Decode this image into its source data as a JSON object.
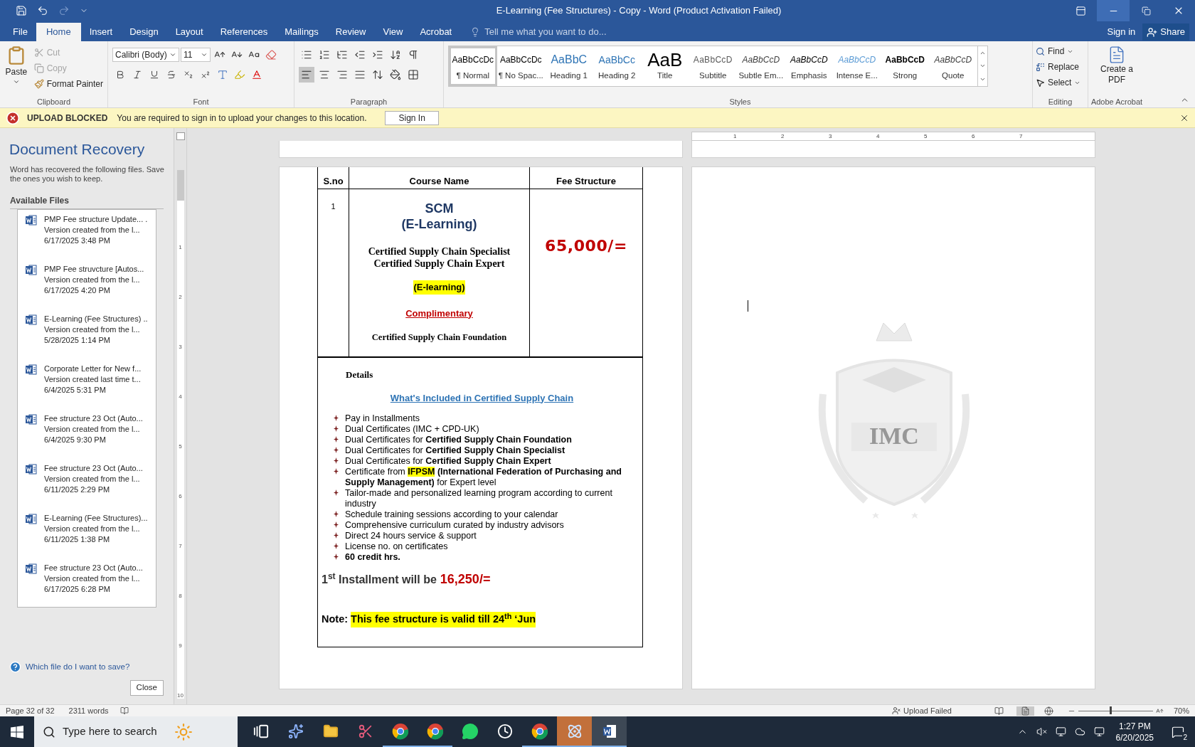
{
  "window": {
    "title": "E-Learning (Fee Structures) - Copy - Word (Product Activation Failed)"
  },
  "menu_tabs": [
    {
      "label": "File",
      "selected": false
    },
    {
      "label": "Home",
      "selected": true
    },
    {
      "label": "Insert",
      "selected": false
    },
    {
      "label": "Design",
      "selected": false
    },
    {
      "label": "Layout",
      "selected": false
    },
    {
      "label": "References",
      "selected": false
    },
    {
      "label": "Mailings",
      "selected": false
    },
    {
      "label": "Review",
      "selected": false
    },
    {
      "label": "View",
      "selected": false
    },
    {
      "label": "Acrobat",
      "selected": false
    }
  ],
  "tell_me": {
    "placeholder": "Tell me what you want to do..."
  },
  "account": {
    "sign_in": "Sign in",
    "share": "Share"
  },
  "ribbon": {
    "clipboard": {
      "paste": "Paste",
      "cut": "Cut",
      "cut_disabled": true,
      "copy": "Copy",
      "copy_disabled": true,
      "format_painter": "Format Painter",
      "label": "Clipboard"
    },
    "font": {
      "name": "Calibri (Body)",
      "size": "11",
      "label": "Font"
    },
    "paragraph": {
      "label": "Paragraph"
    },
    "styles": {
      "label": "Styles",
      "items": [
        {
          "kind": "normal",
          "preview": "AaBbCcDc",
          "label": "¶ Normal",
          "selected": true
        },
        {
          "kind": "no_spacing",
          "preview": "AaBbCcDc",
          "label": "¶ No Spac...",
          "selected": false
        },
        {
          "kind": "heading1",
          "preview": "AaBbC",
          "label": "Heading 1",
          "selected": false
        },
        {
          "kind": "heading2",
          "preview": "AaBbCc",
          "label": "Heading 2",
          "selected": false
        },
        {
          "kind": "title",
          "preview": "AaB",
          "label": "Title",
          "selected": false
        },
        {
          "kind": "subtitle",
          "preview": "AaBbCcD",
          "label": "Subtitle",
          "selected": false
        },
        {
          "kind": "subtle_emphasis",
          "preview": "AaBbCcD",
          "label": "Subtle Em...",
          "selected": false
        },
        {
          "kind": "emphasis",
          "preview": "AaBbCcD",
          "label": "Emphasis",
          "selected": false
        },
        {
          "kind": "intense_emphasis",
          "preview": "AaBbCcD",
          "label": "Intense E...",
          "selected": false
        },
        {
          "kind": "strong",
          "preview": "AaBbCcD",
          "label": "Strong",
          "selected": false
        },
        {
          "kind": "quote",
          "preview": "AaBbCcD",
          "label": "Quote",
          "selected": false
        }
      ]
    },
    "editing": {
      "find": "Find",
      "replace": "Replace",
      "select": "Select",
      "label": "Editing"
    },
    "acrobat": {
      "button": "Create a PDF",
      "label": "Adobe Acrobat"
    }
  },
  "message_bar": {
    "title": "UPLOAD BLOCKED",
    "text": "You are required to sign in to upload your changes to this location.",
    "button": "Sign In"
  },
  "recovery": {
    "title": "Document Recovery",
    "description": "Word has recovered the following files. Save the ones you wish to keep.",
    "list_heading": "Available Files",
    "files": [
      {
        "name": "PMP Fee structure Update... .",
        "detail": "Version created from the l...",
        "date": "6/17/2025 3:48 PM"
      },
      {
        "name": "PMP Fee struvcture  [Autos...",
        "detail": "Version created from the l...",
        "date": "6/17/2025 4:20 PM"
      },
      {
        "name": "E-Learning (Fee Structures) ..",
        "detail": "Version created from the l...",
        "date": "5/28/2025 1:14 PM"
      },
      {
        "name": "Corporate Letter for New f...",
        "detail": "Version created last time t...",
        "date": "6/4/2025 5:31 PM"
      },
      {
        "name": "Fee structure 23 Oct (Auto...",
        "detail": "Version created from the l...",
        "date": "6/4/2025 9:30 PM"
      },
      {
        "name": "Fee structure 23 Oct (Auto...",
        "detail": "Version created from the l...",
        "date": "6/11/2025 2:29 PM"
      },
      {
        "name": "E-Learning (Fee Structures)...",
        "detail": "Version created from the l...",
        "date": "6/11/2025 1:38 PM"
      },
      {
        "name": "Fee structure 23 Oct (Auto...",
        "detail": "Version created from the l...",
        "date": "6/17/2025 6:28 PM"
      }
    ],
    "help_link": "Which file do I want to save?",
    "close": "Close"
  },
  "horizontal_ruler": [
    "1",
    "2",
    "3",
    "4",
    "5",
    "6",
    "7"
  ],
  "vertical_ruler": [
    "1",
    "2",
    "3",
    "4",
    "5",
    "6",
    "7",
    "8",
    "9",
    "10"
  ],
  "document": {
    "table": {
      "columns": [
        "S.no",
        "Course Name",
        "Fee Structure"
      ],
      "row": {
        "sno": "1",
        "course_title": "SCM",
        "course_subtitle": "(E-Learning)",
        "certifications": [
          "Certified Supply Chain Specialist",
          "Certified Supply Chain Expert"
        ],
        "mode": "(E-learning)",
        "complimentary": "Complimentary",
        "complimentary_course": "Certified Supply Chain Foundation",
        "fee": "65,000/="
      }
    },
    "details": {
      "heading": "Details",
      "link": "What's Included in Certified Supply Chain",
      "bullets": [
        [
          {
            "text": "Pay in Installments",
            "bold": false,
            "highlight": false
          }
        ],
        [
          {
            "text": "Dual Certificates (IMC + CPD-UK)",
            "bold": false,
            "highlight": false
          }
        ],
        [
          {
            "text": "Dual Certificates for ",
            "bold": false,
            "highlight": false
          },
          {
            "text": "Certified Supply Chain Foundation",
            "bold": true,
            "highlight": false
          }
        ],
        [
          {
            "text": "Dual Certificates for ",
            "bold": false,
            "highlight": false
          },
          {
            "text": "Certified Supply Chain Specialist",
            "bold": true,
            "highlight": false
          }
        ],
        [
          {
            "text": "Dual Certificates for ",
            "bold": false,
            "highlight": false
          },
          {
            "text": "Certified Supply Chain Expert",
            "bold": true,
            "highlight": false
          }
        ],
        [
          {
            "text": "Certificate from ",
            "bold": false,
            "highlight": false
          },
          {
            "text": "IFPSM",
            "bold": true,
            "highlight": true
          },
          {
            "text": " (International Federation of Purchasing and Supply Management)",
            "bold": true,
            "highlight": false
          },
          {
            "text": " for Expert level",
            "bold": false,
            "highlight": false
          }
        ],
        [
          {
            "text": "Tailor-made and personalized learning program according to current industry",
            "bold": false,
            "highlight": false
          }
        ],
        [
          {
            "text": "Schedule training sessions according to your calendar",
            "bold": false,
            "highlight": false
          }
        ],
        [
          {
            "text": "Comprehensive curriculum curated by industry advisors",
            "bold": false,
            "highlight": false
          }
        ],
        [
          {
            "text": "Direct 24 hours service & support",
            "bold": false,
            "highlight": false
          }
        ],
        [
          {
            "text": "License no. on certificates",
            "bold": false,
            "highlight": false
          }
        ],
        [
          {
            "text": "60 credit hrs.",
            "bold": true,
            "highlight": false
          }
        ]
      ],
      "installment": "1$^{st}$ Installment will be",
      "installment_amount": "16,250/=",
      "note_label": "Note:",
      "note": "This fee structure is valid till 24$^{th}$ ‘Jun"
    },
    "watermark_text": "IMC"
  },
  "status_bar": {
    "page": "Page 32 of 32",
    "words": "2311 words",
    "upload": "Upload Failed",
    "zoom": "70%",
    "zoom_slider": {
      "level": 0.42
    }
  },
  "taskbar": {
    "search_placeholder": "Type here to search",
    "apps": [
      {
        "kind": "task-view",
        "running": false,
        "active": false,
        "attention": false
      },
      {
        "kind": "copilot",
        "running": false,
        "active": false,
        "attention": false
      },
      {
        "kind": "folder",
        "running": false,
        "active": false,
        "attention": false
      },
      {
        "kind": "snip",
        "running": false,
        "active": false,
        "attention": false
      },
      {
        "kind": "chrome",
        "running": true,
        "active": false,
        "attention": false
      },
      {
        "kind": "chrome",
        "running": true,
        "active": false,
        "attention": false
      },
      {
        "kind": "whatsapp",
        "running": false,
        "active": false,
        "attention": false
      },
      {
        "kind": "clock",
        "running": false,
        "active": false,
        "attention": false
      },
      {
        "kind": "chrome",
        "running": true,
        "active": false,
        "attention": false
      },
      {
        "kind": "atom",
        "running": true,
        "active": false,
        "attention": true
      },
      {
        "kind": "word",
        "running": true,
        "active": true,
        "attention": false
      }
    ],
    "time": "1:27 PM",
    "date": "6/20/2025",
    "notifications": "2"
  }
}
